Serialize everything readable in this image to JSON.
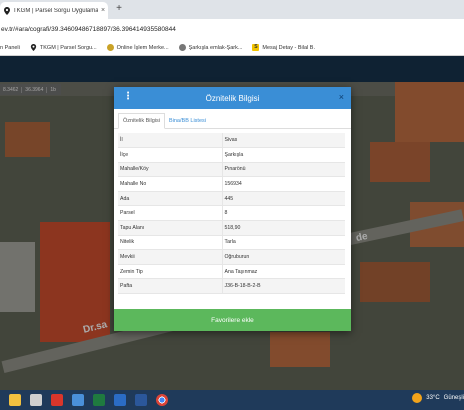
{
  "browser": {
    "tab_title": "TKGM | Parsel Sorgu Uygulama...",
    "tab_close": "×",
    "new_tab": "+",
    "url": "ev.tr/#ara/cografi/39.34609486718897/36.396414935580844"
  },
  "bookmarks": [
    {
      "label": "n Paneli",
      "icon_color": "#555555"
    },
    {
      "label": "TKGM | Parsel Sorgu...",
      "icon_color": "#333333"
    },
    {
      "label": "Online İşlem Merke...",
      "icon_color": "#c9a227"
    },
    {
      "label": "Şarkışla emlak-Şark...",
      "icon_color": "#6a6a6a"
    },
    {
      "label": "Mesaj Detay - Bilal B.",
      "icon_color": "#f2c400"
    }
  ],
  "map": {
    "coords": [
      "8.3462",
      "36.3964",
      "1b"
    ],
    "street_label": "Dr.sa",
    "street_label2": "de"
  },
  "modal": {
    "title": "Öznitelik Bilgisi",
    "menu_glyph": "⋮",
    "close_glyph": "×",
    "tabs": [
      "Öznitelik Bilgisi",
      "Bina/BB Listesi"
    ],
    "rows": [
      {
        "key": "İl",
        "value": "Sivas"
      },
      {
        "key": "İlçe",
        "value": "Şarkışla"
      },
      {
        "key": "Mahalle/Köy",
        "value": "Pınarönü"
      },
      {
        "key": "Mahalle No",
        "value": "156934"
      },
      {
        "key": "Ada",
        "value": "445"
      },
      {
        "key": "Parsel",
        "value": "8"
      },
      {
        "key": "Tapu Alanı",
        "value": "518,90"
      },
      {
        "key": "Nitelik",
        "value": "Tarla"
      },
      {
        "key": "Mevkii",
        "value": "Oğruburun"
      },
      {
        "key": "Zemin Tip",
        "value": "Ana Taşınmaz"
      },
      {
        "key": "Pafta",
        "value": "J36-B-18-B-2-B"
      }
    ],
    "favorite_button": "Favorilere ekle",
    "accent_color": "#3a8ed6",
    "button_color": "#5cb85c"
  },
  "taskbar": {
    "temperature": "33°C",
    "weather": "Güneşli"
  }
}
